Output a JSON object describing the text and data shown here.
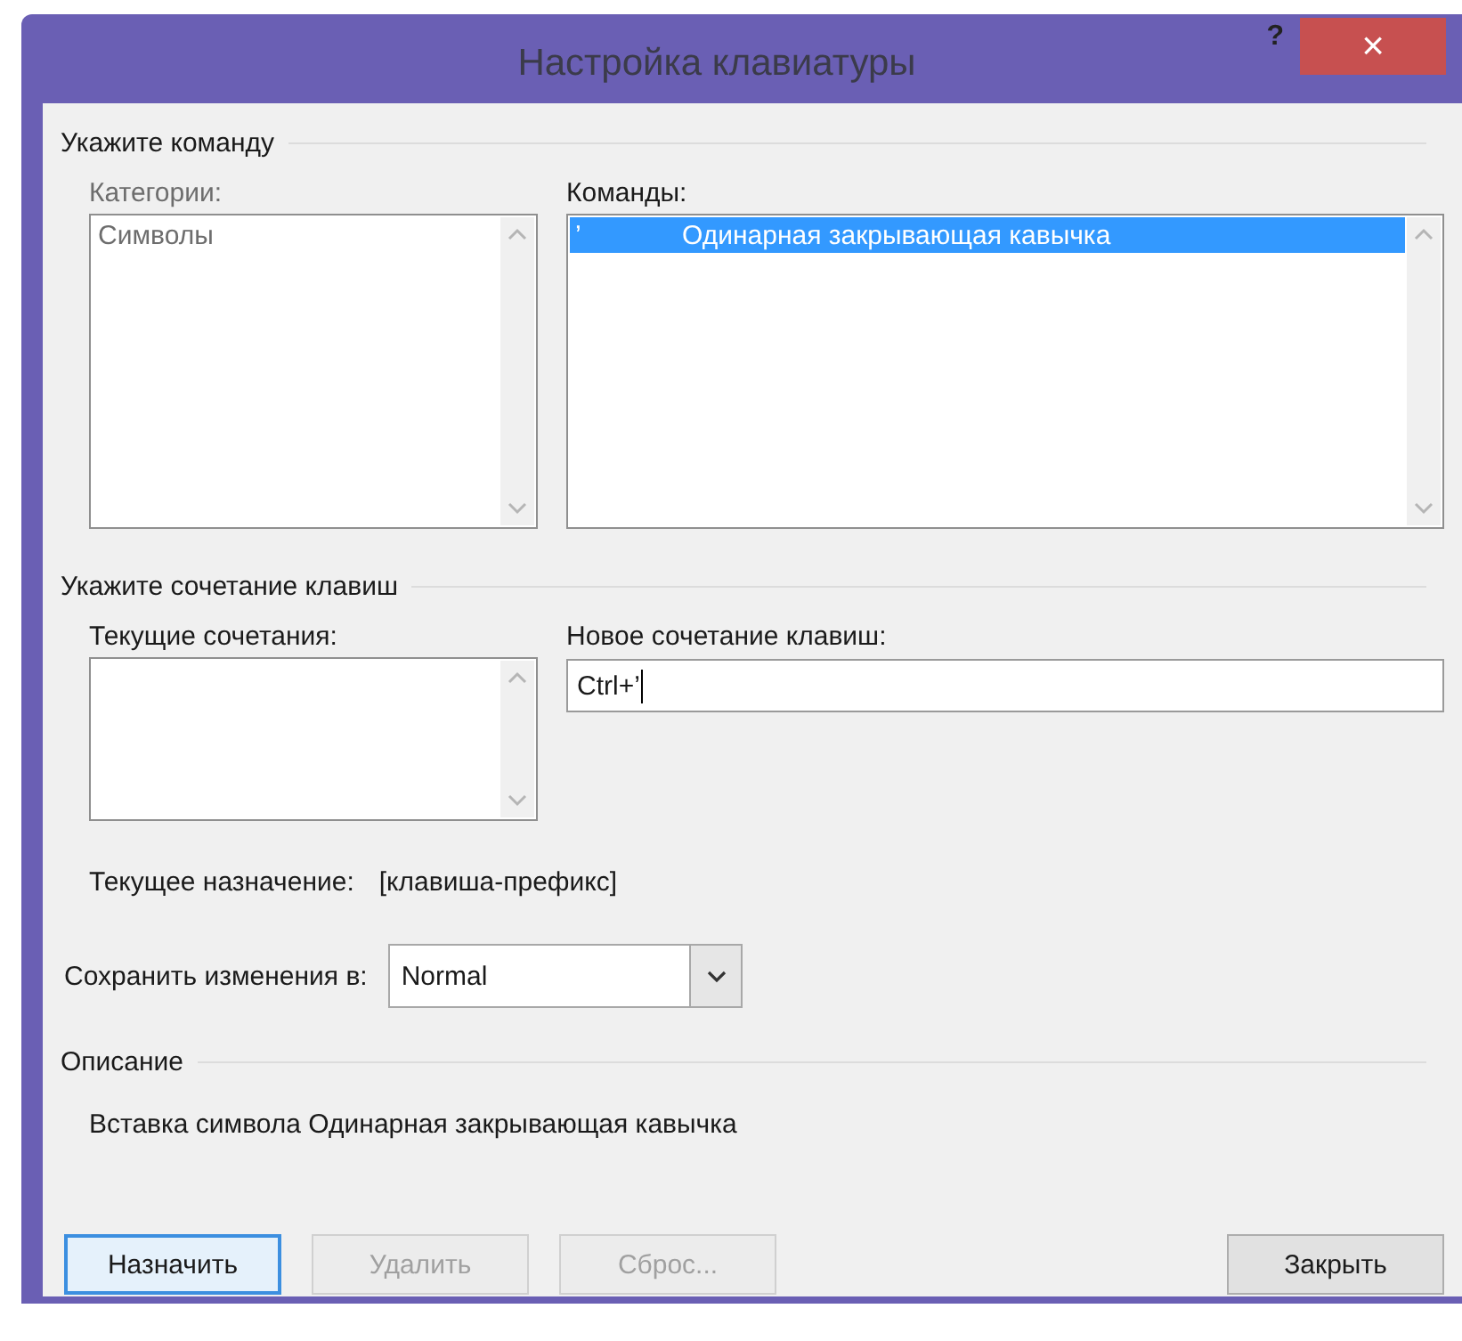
{
  "window": {
    "title": "Настройка клавиатуры",
    "help": "?",
    "close": "×"
  },
  "command_section": {
    "title": "Укажите команду",
    "categories": {
      "label": "Категории:",
      "disabled": true,
      "items": [
        {
          "text": "Символы",
          "selected": false
        }
      ]
    },
    "commands": {
      "label": "Команды:",
      "disabled": false,
      "items": [
        {
          "symbol": "’",
          "text": "Одинарная закрывающая кавычка",
          "selected": true
        }
      ]
    }
  },
  "shortcut_section": {
    "title": "Укажите сочетание клавиш",
    "current_keys": {
      "label": "Текущие сочетания:"
    },
    "new_shortcut": {
      "label": "Новое сочетание клавиш:",
      "value": "Ctrl+’"
    },
    "current_assignment": {
      "label": "Текущее назначение:",
      "value": "[клавиша-префикс]"
    }
  },
  "save_in": {
    "label": "Сохранить изменения в:",
    "value": "Normal"
  },
  "description": {
    "title": "Описание",
    "text": "Вставка символа Одинарная закрывающая кавычка"
  },
  "buttons": [
    {
      "label": "Назначить",
      "disabled": false,
      "default": true
    },
    {
      "label": "Удалить",
      "disabled": true,
      "default": false
    },
    {
      "label": "Сброс...",
      "disabled": true,
      "default": false
    },
    {
      "label": "Закрыть",
      "disabled": false,
      "default": false
    }
  ]
}
